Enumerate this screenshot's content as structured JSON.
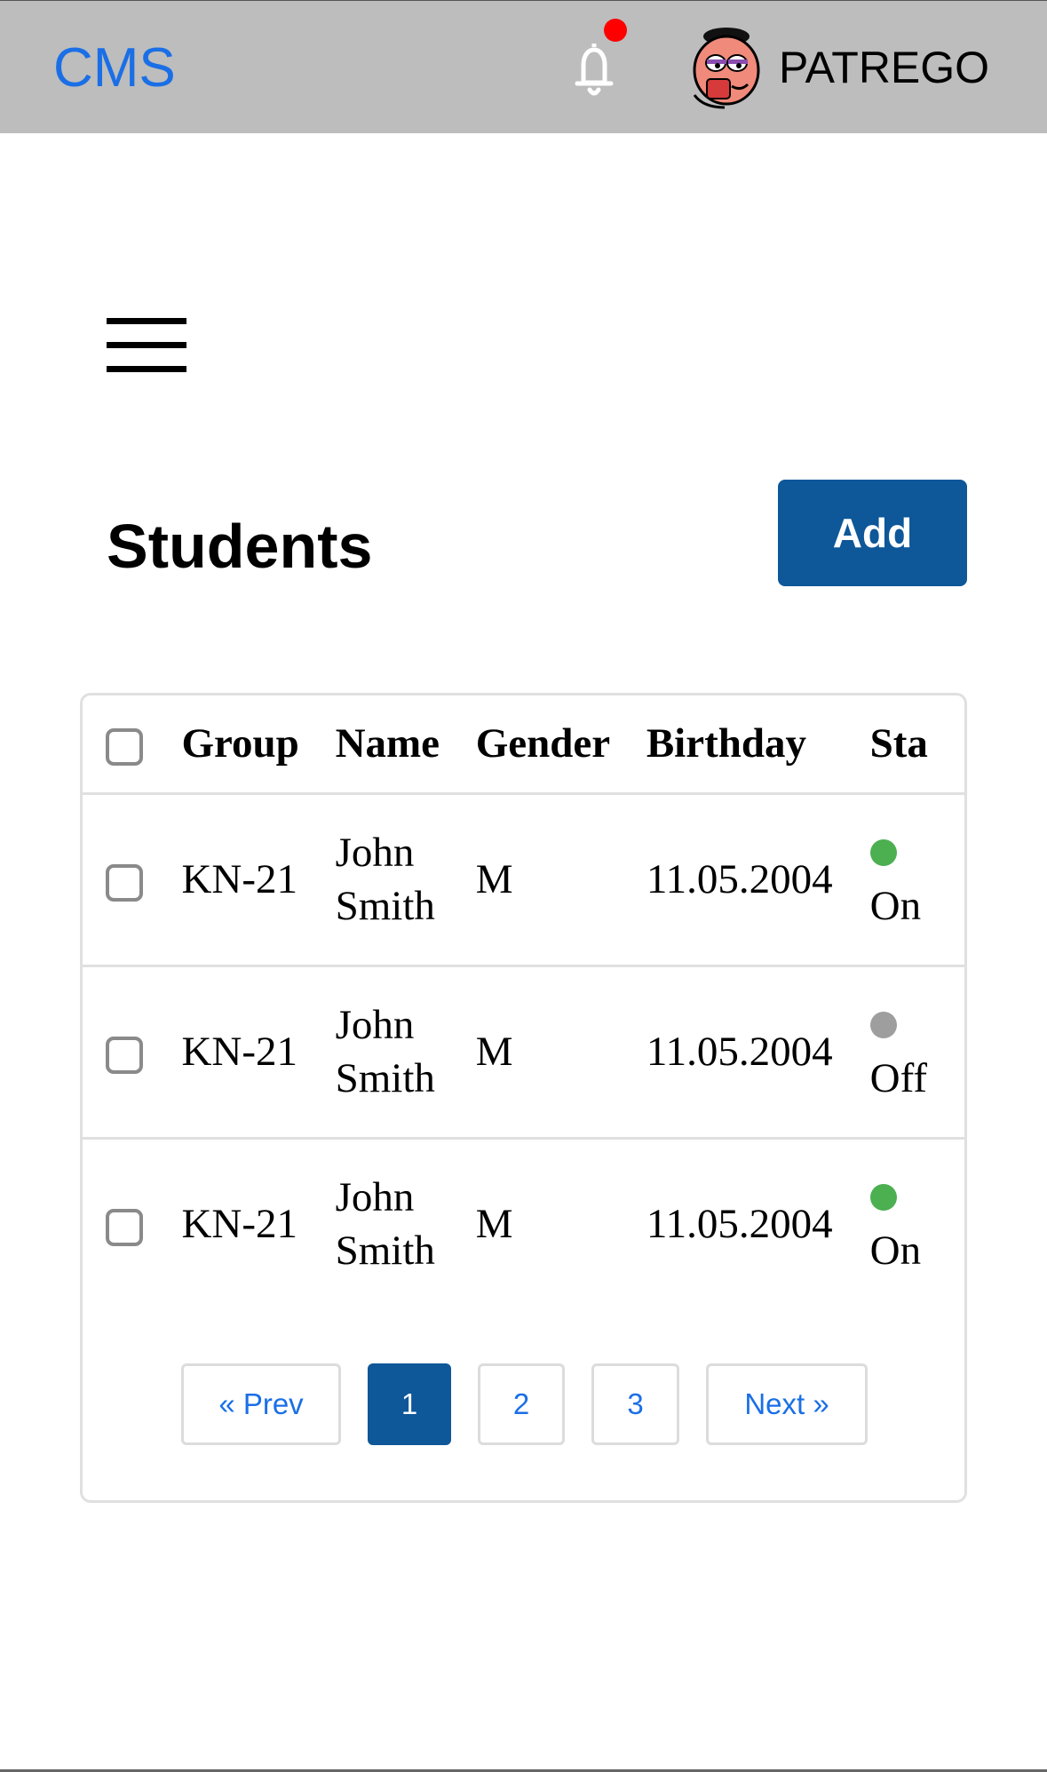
{
  "header": {
    "brand": "CMS",
    "username": "PATREGO",
    "notification_dot_color": "#ff0000"
  },
  "main": {
    "title": "Students",
    "add_label": "Add"
  },
  "table": {
    "columns": [
      "Group",
      "Name",
      "Gender",
      "Birthday",
      "Sta"
    ],
    "rows": [
      {
        "group": "KN-21",
        "name_first": "John",
        "name_last": "Smith",
        "gender": "M",
        "birthday": "11.05.2004",
        "status": "On",
        "status_color": "#4caf50"
      },
      {
        "group": "KN-21",
        "name_first": "John",
        "name_last": "Smith",
        "gender": "M",
        "birthday": "11.05.2004",
        "status": "Off",
        "status_color": "#9e9e9e"
      },
      {
        "group": "KN-21",
        "name_first": "John",
        "name_last": "Smith",
        "gender": "M",
        "birthday": "11.05.2004",
        "status": "On",
        "status_color": "#4caf50"
      }
    ]
  },
  "pagination": {
    "prev": "« Prev",
    "pages": [
      "1",
      "2",
      "3"
    ],
    "active_page": "1",
    "next": "Next »"
  },
  "icons": {
    "bell": "bell-icon",
    "menu": "hamburger-menu-icon",
    "avatar": "avatar"
  },
  "colors": {
    "accent": "#0e5799",
    "link": "#1a6fe6",
    "topbar": "#bdbdbd"
  }
}
